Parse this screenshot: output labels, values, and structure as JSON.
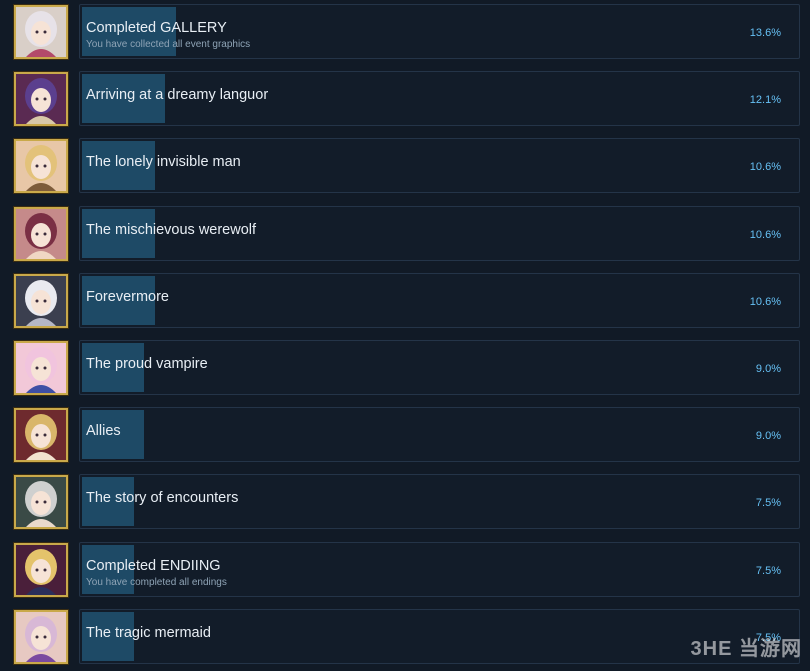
{
  "achievements": [
    {
      "title": "Completed GALLERY",
      "description": "You have collected all event graphics",
      "percent": "13.6%",
      "fill": 0.136,
      "portrait": {
        "bg": "#d9cfc8",
        "hair": "#e7e2e8",
        "accent": "#b34a6a"
      }
    },
    {
      "title": "Arriving at a dreamy languor",
      "description": "",
      "percent": "12.1%",
      "fill": 0.121,
      "portrait": {
        "bg": "#5a2a52",
        "hair": "#5b3f8e",
        "accent": "#d8c8a8"
      }
    },
    {
      "title": "The lonely invisible man",
      "description": "",
      "percent": "10.6%",
      "fill": 0.106,
      "portrait": {
        "bg": "#e8c7a7",
        "hair": "#e3c27a",
        "accent": "#7d5b3a"
      }
    },
    {
      "title": "The mischievous werewolf",
      "description": "",
      "percent": "10.6%",
      "fill": 0.106,
      "portrait": {
        "bg": "#c58a8a",
        "hair": "#7a2f44",
        "accent": "#f0d7c4"
      }
    },
    {
      "title": "Forevermore",
      "description": "",
      "percent": "10.6%",
      "fill": 0.106,
      "portrait": {
        "bg": "#3b3f4f",
        "hair": "#e9eaf0",
        "accent": "#b5b7c6"
      }
    },
    {
      "title": "The proud vampire",
      "description": "",
      "percent": "9.0%",
      "fill": 0.09,
      "portrait": {
        "bg": "#f2c8d8",
        "hair": "#f1c4de",
        "accent": "#3e4fa5"
      }
    },
    {
      "title": "Allies",
      "description": "",
      "percent": "9.0%",
      "fill": 0.09,
      "portrait": {
        "bg": "#6e2a2e",
        "hair": "#d9b66a",
        "accent": "#f2e2cf"
      }
    },
    {
      "title": "The story of encounters",
      "description": "",
      "percent": "7.5%",
      "fill": 0.075,
      "portrait": {
        "bg": "#3a4a46",
        "hair": "#cfd0cf",
        "accent": "#e9d9cc"
      }
    },
    {
      "title": "Completed ENDIING",
      "description": "You have completed all endings",
      "percent": "7.5%",
      "fill": 0.075,
      "portrait": {
        "bg": "#4a1f3a",
        "hair": "#e4c36b",
        "accent": "#2b2f5a"
      }
    },
    {
      "title": "The tragic mermaid",
      "description": "",
      "percent": "7.5%",
      "fill": 0.075,
      "portrait": {
        "bg": "#e7c9c2",
        "hair": "#d8b8d6",
        "accent": "#7b4aa0"
      }
    }
  ],
  "watermark": "3HE 当游网"
}
